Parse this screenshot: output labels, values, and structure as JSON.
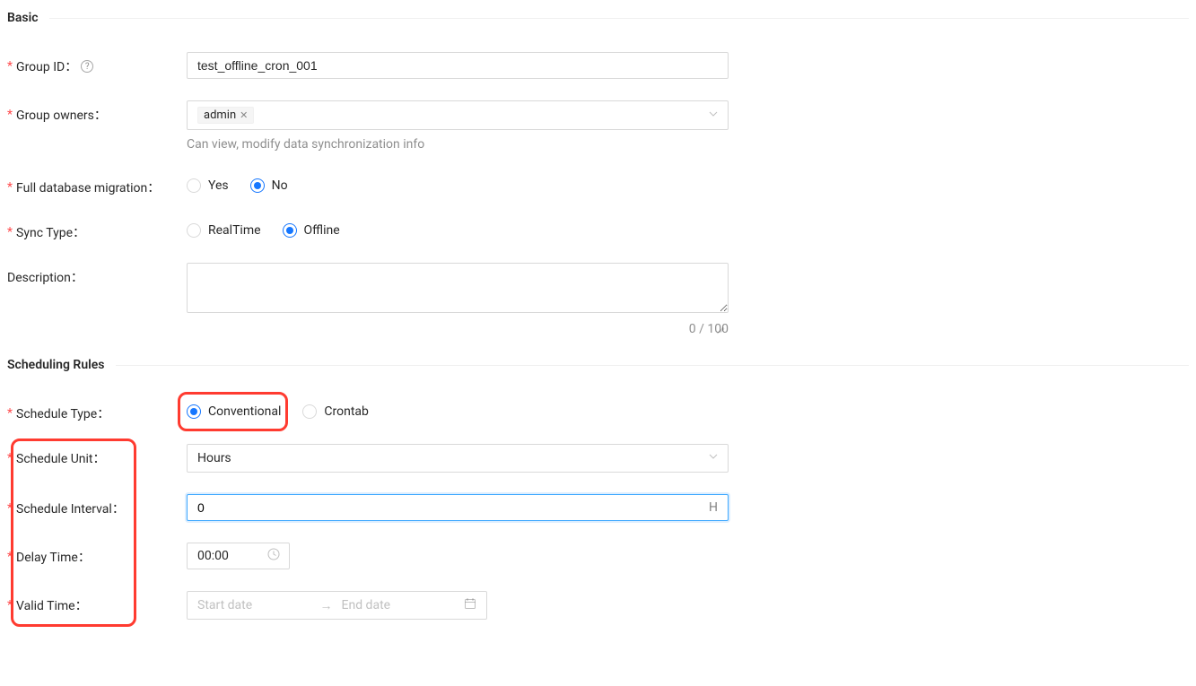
{
  "sections": {
    "basic": "Basic",
    "scheduling": "Scheduling Rules"
  },
  "basic": {
    "groupId": {
      "label": "Group ID",
      "value": "test_offline_cron_001"
    },
    "groupOwners": {
      "label": "Group owners",
      "tag": "admin",
      "helper": "Can view, modify data synchronization info"
    },
    "fullDbMigration": {
      "label": "Full database migration",
      "options": {
        "yes": "Yes",
        "no": "No"
      },
      "selected": "no"
    },
    "syncType": {
      "label": "Sync Type",
      "options": {
        "realtime": "RealTime",
        "offline": "Offline"
      },
      "selected": "offline"
    },
    "description": {
      "label": "Description",
      "value": "",
      "counter": "0 / 100"
    }
  },
  "scheduling": {
    "scheduleType": {
      "label": "Schedule Type",
      "options": {
        "conventional": "Conventional",
        "crontab": "Crontab"
      },
      "selected": "conventional"
    },
    "scheduleUnit": {
      "label": "Schedule Unit",
      "value": "Hours"
    },
    "scheduleInterval": {
      "label": "Schedule Interval",
      "value": "0",
      "suffix": "H"
    },
    "delayTime": {
      "label": "Delay Time",
      "value": "00:00"
    },
    "validTime": {
      "label": "Valid Time",
      "startPlaceholder": "Start date",
      "endPlaceholder": "End date"
    }
  }
}
